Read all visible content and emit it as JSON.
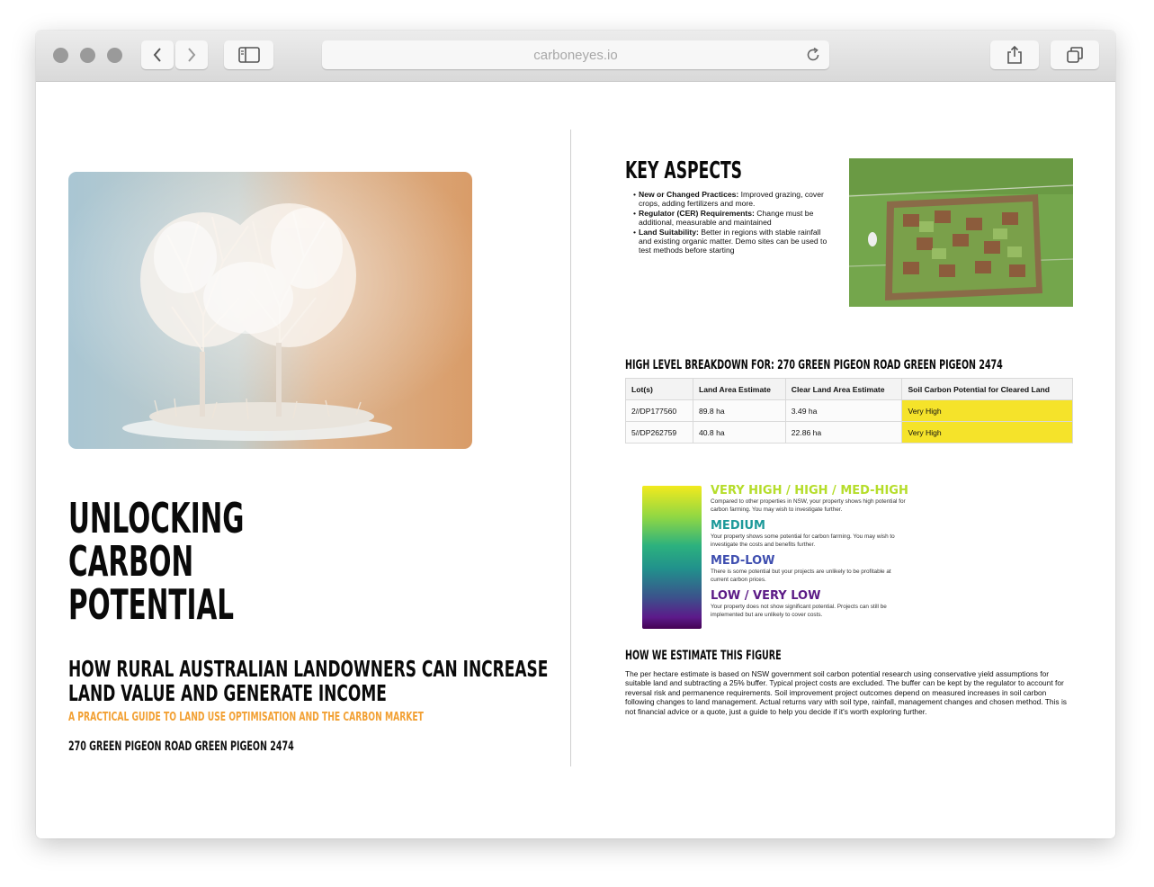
{
  "browser": {
    "url": "carboneyes.io"
  },
  "left": {
    "title_lines": [
      "UNLOCKING",
      "CARBON",
      "POTENTIAL"
    ],
    "subtitle_lines": [
      "HOW RURAL AUSTRALIAN LANDOWNERS CAN INCREASE",
      "LAND VALUE AND GENERATE INCOME"
    ],
    "tagline": "A PRACTICAL GUIDE TO LAND USE OPTIMISATION AND THE CARBON MARKET",
    "address": "270 GREEN PIGEON ROAD GREEN PIGEON 2474"
  },
  "key_aspects": {
    "title": "KEY ASPECTS",
    "items": [
      {
        "label": "New or Changed Practices:",
        "text": " Improved grazing, cover crops, adding fertilizers and more."
      },
      {
        "label": "Regulator (CER) Requirements:",
        "text": " Change must be additional, measurable and maintained"
      },
      {
        "label": "Land Suitability:",
        "text": " Better in regions with stable rainfall and existing organic matter. Demo sites can be used to test methods before starting"
      }
    ]
  },
  "breakdown": {
    "title": "HIGH LEVEL BREAKDOWN FOR: 270 GREEN PIGEON ROAD GREEN PIGEON 2474",
    "headers": [
      "Lot(s)",
      "Land Area Estimate",
      "Clear Land Area Estimate",
      "Soil Carbon Potential for Cleared Land"
    ],
    "rows": [
      [
        "2//DP177560",
        "89.8 ha",
        "3.49 ha",
        "Very High"
      ],
      [
        "5//DP262759",
        "40.8 ha",
        "22.86 ha",
        "Very High"
      ]
    ],
    "highlight_color": "#f5e32a"
  },
  "legend": [
    {
      "heading": "VERY HIGH / HIGH / MED-HIGH",
      "color": "#b5dd2a",
      "text": "Compared to other properties in NSW, your property shows high potential for carbon farming. You may wish to investigate further."
    },
    {
      "heading": "MEDIUM",
      "color": "#1e9a9a",
      "text": "Your property shows some potential for carbon farming. You may wish to investigate the costs and benefits further."
    },
    {
      "heading": "MED-LOW",
      "color": "#3f4fb0",
      "text": "There is some potential but your projects are unlikely to be profitable at current carbon prices."
    },
    {
      "heading": "LOW / VERY LOW",
      "color": "#5b1a86",
      "text": "Your property does not show significant potential. Projects can still be implemented but are unlikely to cover costs."
    }
  ],
  "how": {
    "title": "HOW WE ESTIMATE THIS FIGURE",
    "text": "The per hectare estimate is based on NSW government soil carbon potential research using conservative yield assumptions for suitable land and subtracting a 25% buffer. Typical project costs are excluded. The buffer can be kept by the regulator to account for reversal risk and permanence requirements. Soil improvement project outcomes depend on measured increases in soil carbon following changes to land management. Actual returns vary with soil type, rainfall, management changes and chosen method. This is not financial advice or a quote, just a guide to help you decide if it's worth exploring further."
  }
}
